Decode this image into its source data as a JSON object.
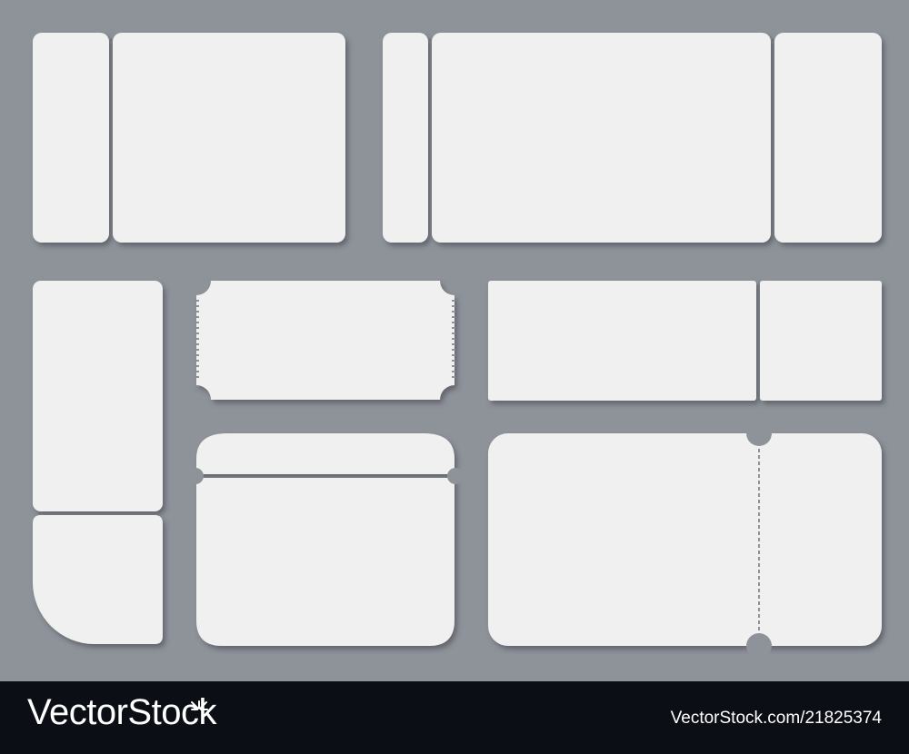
{
  "footer": {
    "brand": "VectorStock",
    "credit": "VectorStock.com/21825374"
  },
  "colors": {
    "background": "#8e939a",
    "ticket": "#f0f0f0",
    "perforation": "#6f737a",
    "footer": "#0c0e15"
  }
}
